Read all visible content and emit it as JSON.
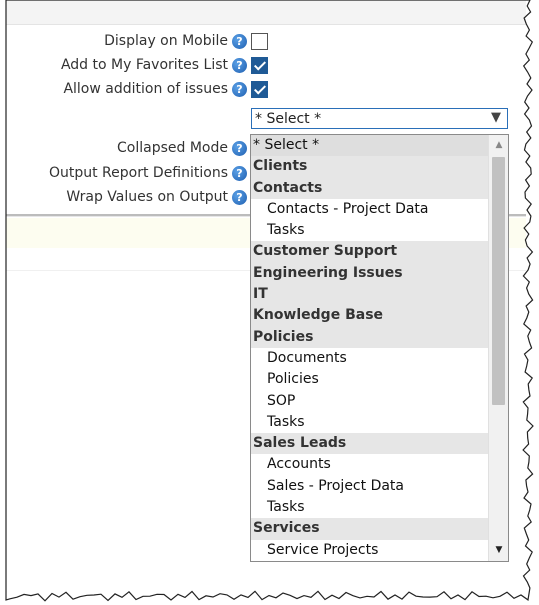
{
  "form": {
    "rows": [
      {
        "label": "Display on Mobile",
        "checked": false
      },
      {
        "label": "Add to My Favorites List",
        "checked": true
      },
      {
        "label": "Allow addition of issues",
        "checked": true
      }
    ],
    "select": {
      "value": "* Select *"
    },
    "collapsed_mode": {
      "label": "Collapsed Mode"
    },
    "output_report": {
      "label": "Output Report Definitions"
    },
    "wrap_values": {
      "label": "Wrap Values on Output"
    }
  },
  "help_glyph": "?",
  "dropdown": {
    "options": [
      {
        "label": "* Select *",
        "kind": "selected"
      },
      {
        "label": "Clients",
        "kind": "group"
      },
      {
        "label": "Contacts",
        "kind": "group"
      },
      {
        "label": "Contacts - Project Data",
        "kind": "child"
      },
      {
        "label": "Tasks",
        "kind": "child"
      },
      {
        "label": "Customer Support",
        "kind": "group"
      },
      {
        "label": "Engineering Issues",
        "kind": "group"
      },
      {
        "label": "IT",
        "kind": "group"
      },
      {
        "label": "Knowledge Base",
        "kind": "group"
      },
      {
        "label": "Policies",
        "kind": "group"
      },
      {
        "label": "Documents",
        "kind": "child"
      },
      {
        "label": "Policies",
        "kind": "child"
      },
      {
        "label": "SOP",
        "kind": "child"
      },
      {
        "label": "Tasks",
        "kind": "child"
      },
      {
        "label": "Sales Leads",
        "kind": "group"
      },
      {
        "label": "Accounts",
        "kind": "child"
      },
      {
        "label": "Sales - Project Data",
        "kind": "child"
      },
      {
        "label": "Tasks",
        "kind": "child"
      },
      {
        "label": "Services",
        "kind": "group"
      },
      {
        "label": "Service Projects",
        "kind": "child"
      }
    ]
  },
  "colors": {
    "checkbox_checked": "#1f5a96",
    "select_border": "#2a6fb8",
    "help_icon": "#2d74c4",
    "group_background": "#e6e6e6"
  }
}
